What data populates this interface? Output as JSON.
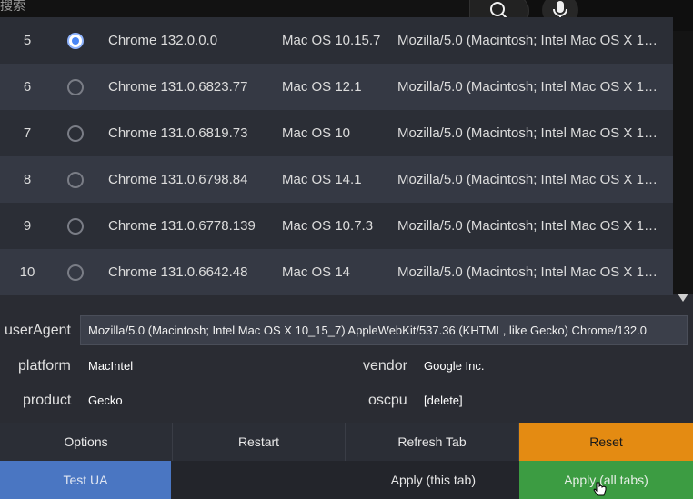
{
  "search": {
    "placeholder": "搜索"
  },
  "table": {
    "rows": [
      {
        "num": "5",
        "browser": "Chrome 132.0.0.0",
        "os": "Mac OS 10.15.7",
        "ua": "Mozilla/5.0 (Macintosh; Intel Mac OS X 1…",
        "selected": true
      },
      {
        "num": "6",
        "browser": "Chrome 131.0.6823.77",
        "os": "Mac OS 12.1",
        "ua": "Mozilla/5.0 (Macintosh; Intel Mac OS X 1…",
        "selected": false
      },
      {
        "num": "7",
        "browser": "Chrome 131.0.6819.73",
        "os": "Mac OS 10",
        "ua": "Mozilla/5.0 (Macintosh; Intel Mac OS X 1…",
        "selected": false
      },
      {
        "num": "8",
        "browser": "Chrome 131.0.6798.84",
        "os": "Mac OS 14.1",
        "ua": "Mozilla/5.0 (Macintosh; Intel Mac OS X 1…",
        "selected": false
      },
      {
        "num": "9",
        "browser": "Chrome 131.0.6778.139",
        "os": "Mac OS 10.7.3",
        "ua": "Mozilla/5.0 (Macintosh; Intel Mac OS X 1…",
        "selected": false
      },
      {
        "num": "10",
        "browser": "Chrome 131.0.6642.48",
        "os": "Mac OS 14",
        "ua": "Mozilla/5.0 (Macintosh; Intel Mac OS X 1…",
        "selected": false
      }
    ]
  },
  "fields": {
    "userAgent_label": "userAgent",
    "userAgent_value": "Mozilla/5.0 (Macintosh; Intel Mac OS X 10_15_7) AppleWebKit/537.36 (KHTML, like Gecko) Chrome/132.0",
    "platform_label": "platform",
    "platform_value": "MacIntel",
    "vendor_label": "vendor",
    "vendor_value": "Google Inc.",
    "product_label": "product",
    "product_value": "Gecko",
    "oscpu_label": "oscpu",
    "oscpu_value": "[delete]"
  },
  "buttons": {
    "options": "Options",
    "restart": "Restart",
    "refresh_tab": "Refresh Tab",
    "reset": "Reset",
    "test_ua": "Test UA",
    "apply_this_tab": "Apply (this tab)",
    "apply_all_tabs": "Apply (all tabs)"
  },
  "colors": {
    "reset": "#e48b12",
    "test_ua": "#4a76c2",
    "apply_all": "#3c9c42",
    "radio_selected": "#4a86f5"
  },
  "icons": {
    "search": "search-icon",
    "mic": "microphone-icon",
    "scroll": "scroll-down-arrow-icon",
    "cursor": "hand-pointer-icon"
  }
}
